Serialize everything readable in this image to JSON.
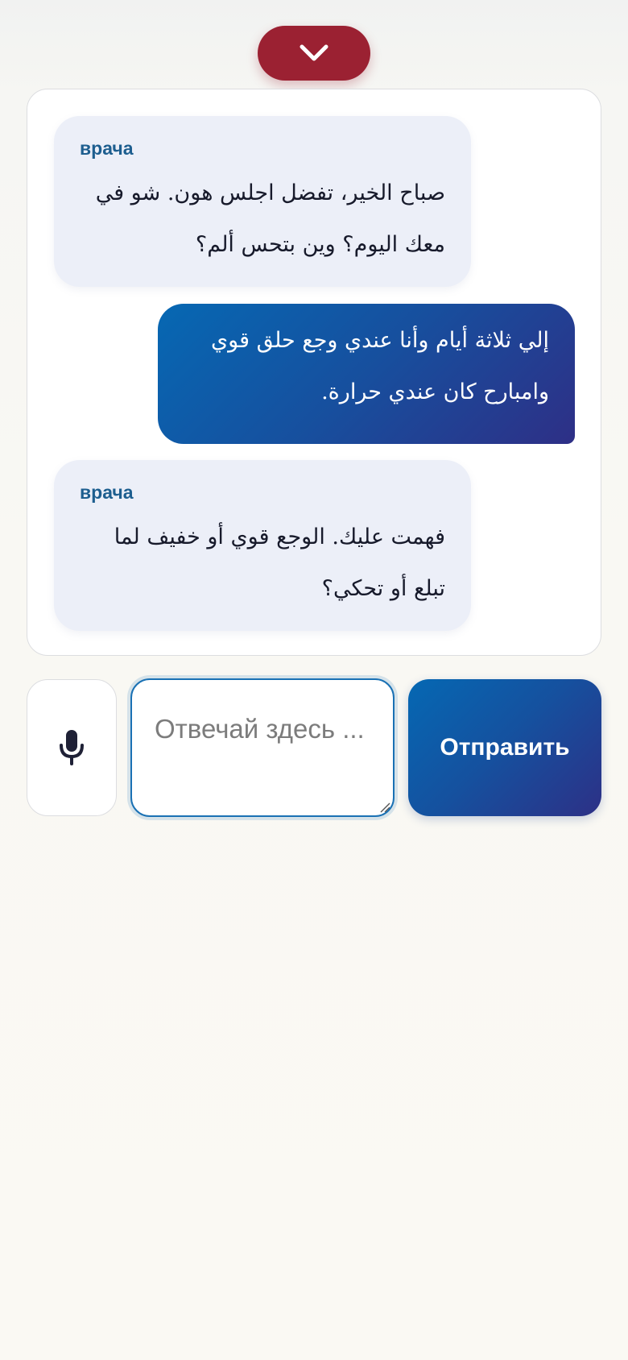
{
  "header": {
    "collapse_icon": "chevron-down-icon",
    "accent_color": "#9b2132"
  },
  "chat": {
    "messages": [
      {
        "role": "doctor",
        "sender": "врача",
        "text": "صباح الخير، تفضل اجلس هون. شو في معك اليوم؟ وين بتحس ألم؟"
      },
      {
        "role": "user",
        "text": "إلي ثلاثة أيام وأنا عندي وجع حلق قوي وامبارح كان عندي حرارة."
      },
      {
        "role": "doctor",
        "sender": "врача",
        "text": "فهمت عليك. الوجع قوي أو خفيف لما تبلع أو تحكي؟"
      }
    ]
  },
  "composer": {
    "mic_icon": "microphone-icon",
    "reply_placeholder": "Отвечай здесь ...",
    "reply_value": "",
    "send_label": "Отправить"
  },
  "colors": {
    "sender_name": "#1d5e8f",
    "doctor_bubble": "#eceff8",
    "user_bubble_start": "#0668b3",
    "user_bubble_end": "#2e2f86"
  }
}
